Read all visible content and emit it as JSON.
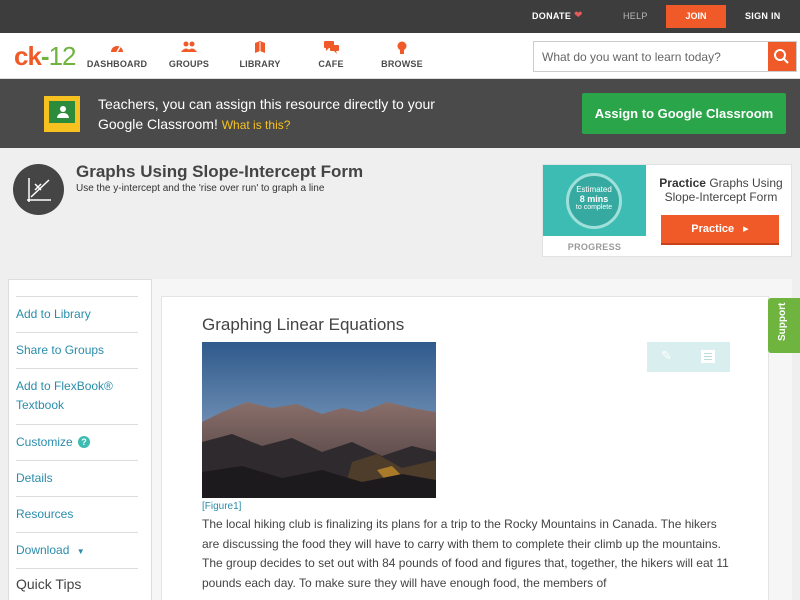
{
  "topbar": {
    "donate": "DONATE",
    "help": "HELP",
    "join": "JOIN",
    "signin": "SIGN IN"
  },
  "nav": {
    "logo": {
      "part1": "ck",
      "part2": "-",
      "part3": "12"
    },
    "items": [
      {
        "label": "DASHBOARD",
        "icon": "dashboard-icon"
      },
      {
        "label": "GROUPS",
        "icon": "groups-icon"
      },
      {
        "label": "LIBRARY",
        "icon": "library-icon"
      },
      {
        "label": "CAFE",
        "icon": "cafe-icon"
      },
      {
        "label": "BROWSE",
        "icon": "browse-icon"
      }
    ],
    "search_placeholder": "What do you want to learn today?"
  },
  "banner": {
    "message": "Teachers, you can assign this resource directly to your Google Classroom!",
    "what_link": "What is this?",
    "assign_button": "Assign to Google Classroom"
  },
  "concept": {
    "title": "Graphs Using Slope-Intercept Form",
    "subtitle": "Use the y-intercept and the 'rise over run' to graph a line"
  },
  "practice": {
    "estimate_top": "Estimated",
    "estimate_mid": "8 mins",
    "estimate_bottom": "to complete",
    "progress": "PROGRESS",
    "title_bold": "Practice",
    "title_rest": "Graphs Using Slope-Intercept Form",
    "button": "Practice"
  },
  "sidebar": {
    "items": [
      "Add to Library",
      "Share to Groups",
      "Add to FlexBook®",
      "Customize",
      "Details",
      "Resources",
      "Download"
    ],
    "flexbook_line2": "Textbook",
    "quick_tips": "Quick Tips"
  },
  "article": {
    "title": "Graphing Linear Equations",
    "figure_label": "[Figure1]",
    "paragraph": "The local hiking club is finalizing its plans for a trip to the Rocky Mountains in Canada. The hikers are discussing the food they will have to carry with them to complete their climb up the mountains. The group decides to set out with 84 pounds of food and figures that, together, the hikers will eat 11 pounds each day. To make sure they will have enough food, the members of"
  },
  "support": "Support",
  "colors": {
    "accent_orange": "#f05a28",
    "brand_green": "#6eb43f",
    "classroom_green": "#2aa54a",
    "link_blue": "#2a8dab",
    "practice_teal": "#3cbcb2"
  }
}
